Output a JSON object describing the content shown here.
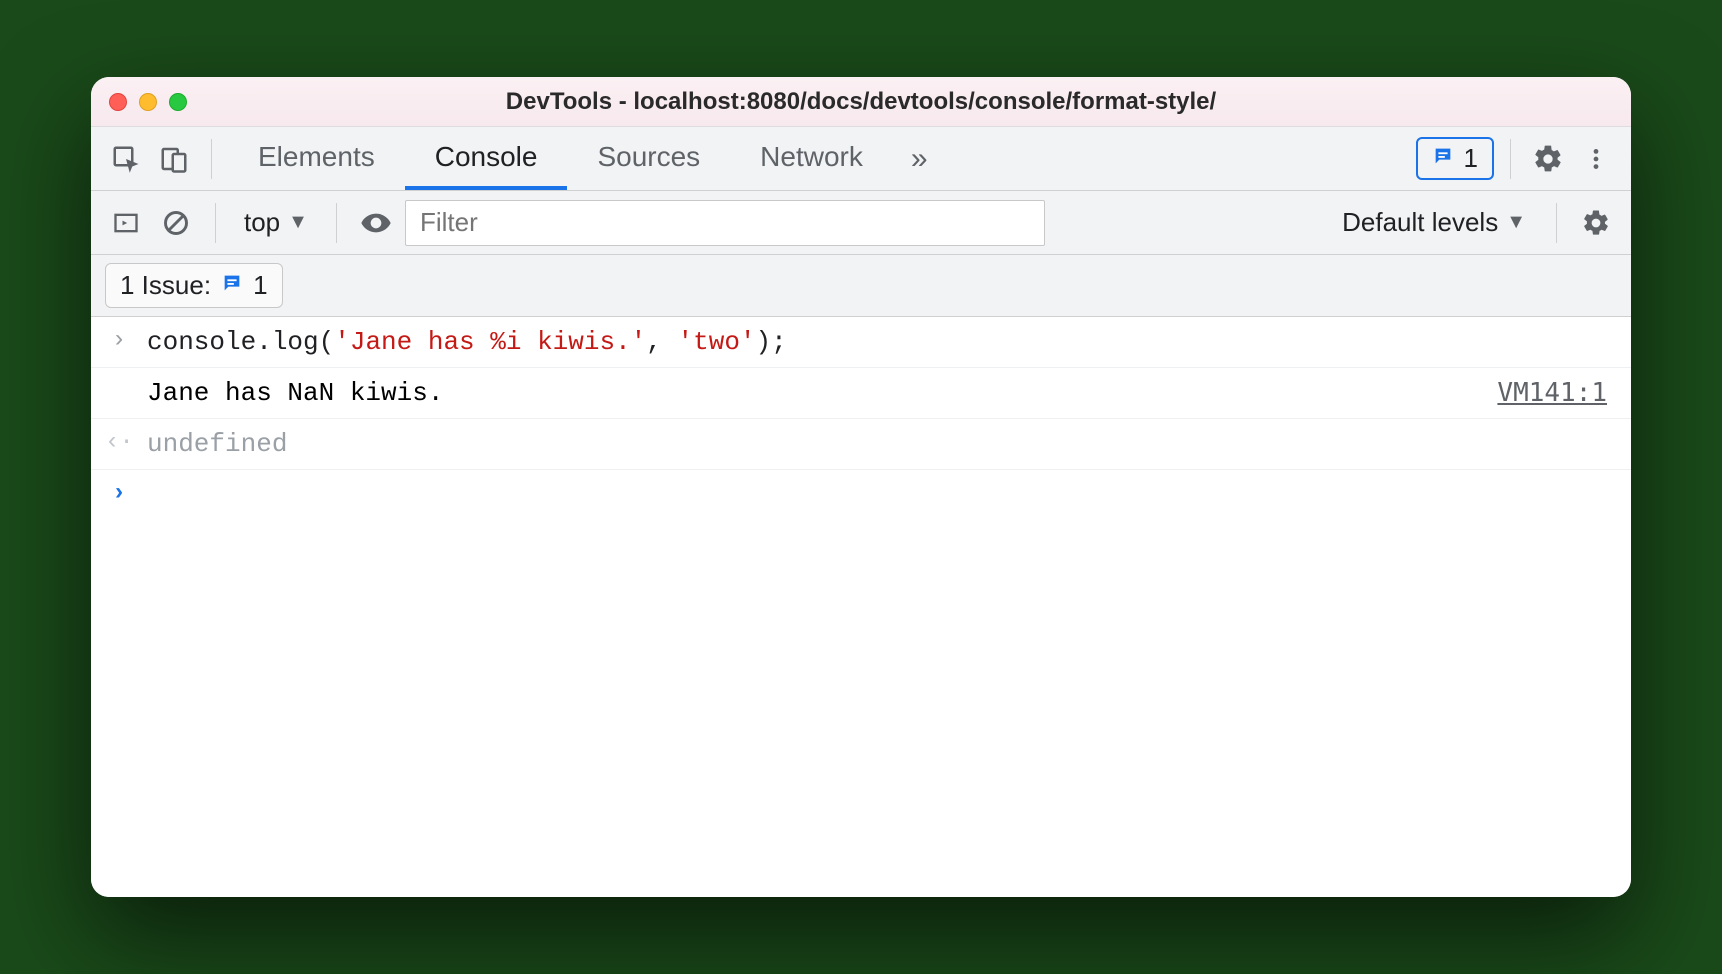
{
  "window": {
    "title": "DevTools - localhost:8080/docs/devtools/console/format-style/"
  },
  "tabs": {
    "items": [
      "Elements",
      "Console",
      "Sources",
      "Network"
    ],
    "active_index": 1,
    "overflow_glyph": "»"
  },
  "toolbar": {
    "issues_count": "1"
  },
  "subbar": {
    "context_label": "top",
    "filter_placeholder": "Filter",
    "levels_label": "Default levels"
  },
  "issuesbar": {
    "label": "1 Issue:",
    "count": "1"
  },
  "console": {
    "entries": [
      {
        "kind": "input",
        "segments": [
          {
            "t": "console.log(",
            "c": "code-default"
          },
          {
            "t": "'Jane has %i kiwis.'",
            "c": "code-string"
          },
          {
            "t": ", ",
            "c": "code-default"
          },
          {
            "t": "'two'",
            "c": "code-string"
          },
          {
            "t": ");",
            "c": "code-default"
          }
        ]
      },
      {
        "kind": "output",
        "text": "Jane has NaN kiwis.",
        "source": "VM141:1"
      },
      {
        "kind": "return",
        "text": "undefined"
      },
      {
        "kind": "prompt"
      }
    ]
  }
}
